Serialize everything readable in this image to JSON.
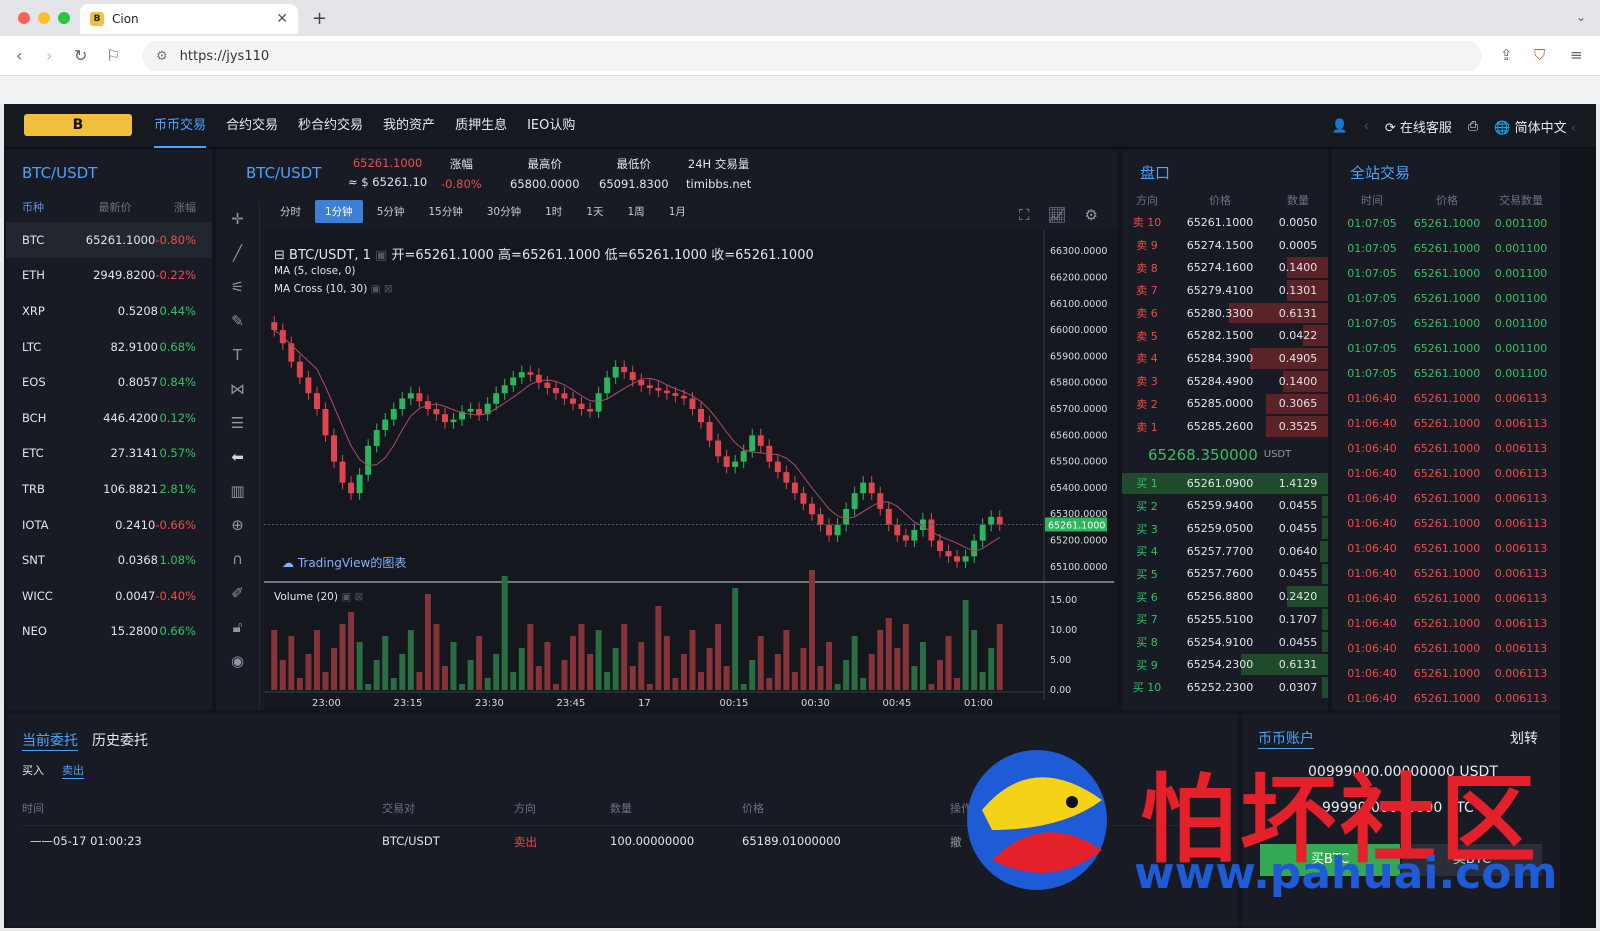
{
  "browser": {
    "tab_title": "Cion",
    "url": "https://jys110",
    "colors": {
      "close": "#ff5f57",
      "min": "#febc2e",
      "max": "#28c840"
    }
  },
  "nav": {
    "items": [
      "币币交易",
      "合约交易",
      "秒合约交易",
      "我的资产",
      "质押生息",
      "IEO认购"
    ],
    "active": 0,
    "service": "在线客服",
    "lang": "简体中文"
  },
  "market": {
    "title": "BTC/USDT",
    "headers": [
      "币种",
      "最新价",
      "涨幅"
    ],
    "rows": [
      [
        "BTC",
        "65261.1000",
        "-0.80%"
      ],
      [
        "ETH",
        "2949.8200",
        "-0.22%"
      ],
      [
        "XRP",
        "0.5208",
        "0.44%"
      ],
      [
        "LTC",
        "82.9100",
        "0.68%"
      ],
      [
        "EOS",
        "0.8057",
        "0.84%"
      ],
      [
        "BCH",
        "446.4200",
        "0.12%"
      ],
      [
        "ETC",
        "27.3141",
        "0.57%"
      ],
      [
        "TRB",
        "106.8821",
        "2.81%"
      ],
      [
        "IOTA",
        "0.2410",
        "-0.66%"
      ],
      [
        "SNT",
        "0.0368",
        "1.08%"
      ],
      [
        "WICC",
        "0.0047",
        "-0.40%"
      ],
      [
        "NEO",
        "15.2800",
        "0.66%"
      ]
    ]
  },
  "ticker": {
    "pair": "BTC/USDT",
    "last": "65261.1000",
    "approx": "≈ $ 65261.10",
    "change_label": "涨幅",
    "change": "-0.80%",
    "high_label": "最高价",
    "high": "65800.0000",
    "low_label": "最低价",
    "low": "65091.8300",
    "vol_label": "24H 交易量",
    "vol": "timibbs.net"
  },
  "chart": {
    "intervals": [
      "分时",
      "1分钟",
      "5分钟",
      "15分钟",
      "30分钟",
      "1时",
      "1天",
      "1周",
      "1月"
    ],
    "active_interval": 1,
    "legend": "BTC/USDT, 1",
    "open": "开=65261.1000",
    "high": "高=65261.1000",
    "low": "低=65261.1000",
    "close": "收=65261.1000",
    "ma": "MA (5, close, 0)",
    "ma_cross": "MA Cross (10, 30)",
    "volume": "Volume (20)",
    "tv": "TradingView的图表",
    "price_label": "65261.1000",
    "y_ticks": [
      "66300.0000",
      "66200.0000",
      "66100.0000",
      "66000.0000",
      "65900.0000",
      "65800.0000",
      "65700.0000",
      "65600.0000",
      "65500.0000",
      "65400.0000",
      "65300.0000",
      "65200.0000",
      "65100.0000"
    ],
    "vol_ticks": [
      "15.00",
      "10.00",
      "5.00",
      "0.00"
    ],
    "x_ticks": [
      "23:00",
      "23:15",
      "23:30",
      "23:45",
      "17",
      "00:15",
      "00:30",
      "00:45",
      "01:00"
    ]
  },
  "chart_data": {
    "type": "candlestick",
    "ylim": [
      65050,
      66350
    ],
    "close_series": [
      66000,
      65950,
      65880,
      65820,
      65760,
      65700,
      65600,
      65500,
      65420,
      65380,
      65450,
      65560,
      65620,
      65660,
      65700,
      65740,
      65760,
      65730,
      65700,
      65680,
      65650,
      65660,
      65690,
      65700,
      65680,
      65720,
      65760,
      65790,
      65820,
      65840,
      65830,
      65800,
      65780,
      65760,
      65740,
      65720,
      65700,
      65690,
      65760,
      65820,
      65860,
      65840,
      65810,
      65790,
      65780,
      65770,
      65760,
      65750,
      65740,
      65700,
      65650,
      65580,
      65520,
      65480,
      65500,
      65540,
      65600,
      65560,
      65500,
      65460,
      65420,
      65380,
      65340,
      65300,
      65260,
      65220,
      65260,
      65320,
      65380,
      65420,
      65380,
      65320,
      65260,
      65220,
      65200,
      65240,
      65280,
      65200,
      65160,
      65140,
      65120,
      65140,
      65200,
      65260,
      65290,
      65261
    ]
  },
  "book": {
    "title": "盘口",
    "headers": [
      "方向",
      "价格",
      "数量"
    ],
    "asks": [
      [
        "卖 10",
        "65261.1000",
        "0.0050",
        0
      ],
      [
        "卖 9",
        "65274.1500",
        "0.0005",
        0
      ],
      [
        "卖 8",
        "65274.1600",
        "0.1400",
        0.2
      ],
      [
        "卖 7",
        "65279.4100",
        "0.1301",
        0.2
      ],
      [
        "卖 6",
        "65280.3300",
        "0.6131",
        0.48
      ],
      [
        "卖 5",
        "65282.1500",
        "0.0422",
        0.12
      ],
      [
        "卖 4",
        "65284.3900",
        "0.4905",
        0.38
      ],
      [
        "卖 3",
        "65284.4900",
        "0.1400",
        0.22
      ],
      [
        "卖 2",
        "65285.0000",
        "0.3065",
        0.3
      ],
      [
        "卖 1",
        "65285.2600",
        "0.3525",
        0.3
      ]
    ],
    "mid": "65268.350000",
    "mid_unit": "USDT",
    "bids": [
      [
        "买 1",
        "65261.0900",
        "1.4129",
        1
      ],
      [
        "买 2",
        "65259.9400",
        "0.0455",
        0.03
      ],
      [
        "买 3",
        "65259.0500",
        "0.0455",
        0.03
      ],
      [
        "买 4",
        "65257.7700",
        "0.0640",
        0.04
      ],
      [
        "买 5",
        "65257.7600",
        "0.0455",
        0.03
      ],
      [
        "买 6",
        "65256.8800",
        "0.2420",
        0.2
      ],
      [
        "买 7",
        "65255.5100",
        "0.1707",
        0.03
      ],
      [
        "买 8",
        "65254.9100",
        "0.0455",
        0.03
      ],
      [
        "买 9",
        "65254.2300",
        "0.6131",
        0.42
      ],
      [
        "买 10",
        "65252.2300",
        "0.0307",
        0.03
      ]
    ]
  },
  "trades": {
    "title": "全站交易",
    "headers": [
      "时间",
      "价格",
      "交易数量"
    ],
    "rows": [
      [
        "01:07:05",
        "65261.1000",
        "0.001100",
        "up"
      ],
      [
        "01:07:05",
        "65261.1000",
        "0.001100",
        "up"
      ],
      [
        "01:07:05",
        "65261.1000",
        "0.001100",
        "up"
      ],
      [
        "01:07:05",
        "65261.1000",
        "0.001100",
        "up"
      ],
      [
        "01:07:05",
        "65261.1000",
        "0.001100",
        "up"
      ],
      [
        "01:07:05",
        "65261.1000",
        "0.001100",
        "up"
      ],
      [
        "01:07:05",
        "65261.1000",
        "0.001100",
        "up"
      ],
      [
        "01:06:40",
        "65261.1000",
        "0.006113",
        "dn"
      ],
      [
        "01:06:40",
        "65261.1000",
        "0.006113",
        "dn"
      ],
      [
        "01:06:40",
        "65261.1000",
        "0.006113",
        "dn"
      ],
      [
        "01:06:40",
        "65261.1000",
        "0.006113",
        "dn"
      ],
      [
        "01:06:40",
        "65261.1000",
        "0.006113",
        "dn"
      ],
      [
        "01:06:40",
        "65261.1000",
        "0.006113",
        "dn"
      ],
      [
        "01:06:40",
        "65261.1000",
        "0.006113",
        "dn"
      ],
      [
        "01:06:40",
        "65261.1000",
        "0.006113",
        "dn"
      ],
      [
        "01:06:40",
        "65261.1000",
        "0.006113",
        "dn"
      ],
      [
        "01:06:40",
        "65261.1000",
        "0.006113",
        "dn"
      ],
      [
        "01:06:40",
        "65261.1000",
        "0.006113",
        "dn"
      ],
      [
        "01:06:40",
        "65261.1000",
        "0.006113",
        "dn"
      ],
      [
        "01:06:40",
        "65261.1000",
        "0.006113",
        "dn"
      ]
    ]
  },
  "orders": {
    "tab_current": "当前委托",
    "tab_history": "历史委托",
    "buy": "买入",
    "sell": "卖出",
    "headers": [
      "时间",
      "交易对",
      "方向",
      "数量",
      "价格",
      "操作"
    ],
    "rows": [
      [
        "——05-17 01:00:23",
        "BTC/USDT",
        "卖出",
        "100.00000000",
        "65189.01000000",
        "撤"
      ]
    ]
  },
  "account": {
    "title": "币币账户",
    "transfer": "划转",
    "usdt": "00999000.00000000 USDT",
    "btc": "99990.00000000 BTC",
    "buy_btc": "买BTC",
    "sell_btc": "卖BTC"
  },
  "watermark": {
    "text": "怕坏社区",
    "url": "www.pahuai.com"
  }
}
